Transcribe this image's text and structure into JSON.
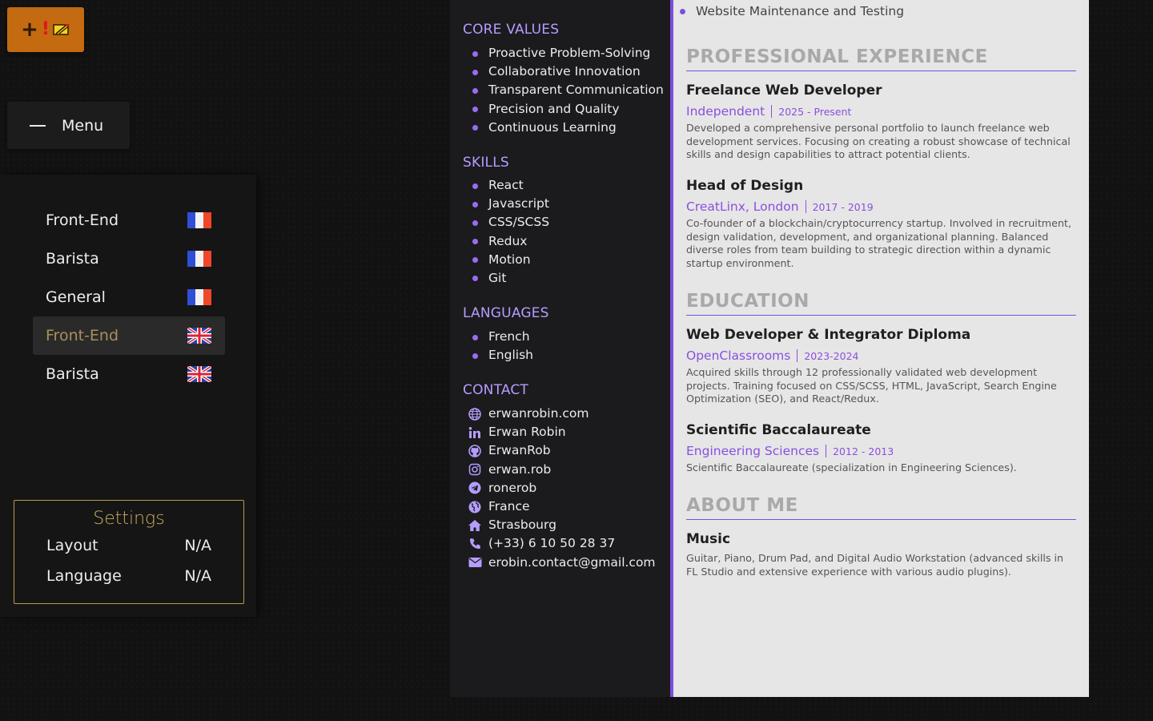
{
  "badge": {
    "plus": "+",
    "exclaim": "!"
  },
  "menu": {
    "label": "Menu"
  },
  "cv_list": [
    {
      "name": "Front-End",
      "lang": "fr",
      "active": false
    },
    {
      "name": "Barista",
      "lang": "fr",
      "active": false
    },
    {
      "name": "General",
      "lang": "fr",
      "active": false
    },
    {
      "name": "Front-End",
      "lang": "uk",
      "active": true
    },
    {
      "name": "Barista",
      "lang": "uk",
      "active": false
    }
  ],
  "settings": {
    "title": "Settings",
    "layout_label": "Layout",
    "layout_value": "N/A",
    "language_label": "Language",
    "language_value": "N/A"
  },
  "resume": {
    "left": {
      "core_values_title": "CORE VALUES",
      "core_values": [
        "Proactive Problem-Solving",
        "Collaborative Innovation",
        "Transparent Communication",
        "Precision and Quality",
        "Continuous Learning"
      ],
      "skills_title": "SKILLS",
      "skills": [
        "React",
        "Javascript",
        "CSS/SCSS",
        "Redux",
        "Motion",
        "Git"
      ],
      "languages_title": "LANGUAGES",
      "languages": [
        "French",
        "English"
      ],
      "contact_title": "CONTACT",
      "contact": [
        {
          "icon": "globe-icon",
          "text": "erwanrobin.com"
        },
        {
          "icon": "linkedin-icon",
          "text": "Erwan Robin"
        },
        {
          "icon": "github-icon",
          "text": "ErwanRob"
        },
        {
          "icon": "instagram-icon",
          "text": "erwan.rob"
        },
        {
          "icon": "telegram-icon",
          "text": "ronerob"
        },
        {
          "icon": "earth-icon",
          "text": "France"
        },
        {
          "icon": "home-icon",
          "text": "Strasbourg"
        },
        {
          "icon": "phone-icon",
          "text": "(+33) 6 10 50 28 37"
        },
        {
          "icon": "mail-icon",
          "text": "erobin.contact@gmail.com"
        }
      ]
    },
    "right": {
      "top_bullet": "Website Maintenance and Testing",
      "experience_title": "PROFESSIONAL EXPERIENCE",
      "experience": [
        {
          "title": "Freelance Web Developer",
          "org": "Independent",
          "period": "2025 - Present",
          "desc": "Developed a comprehensive personal portfolio to launch freelance web development services. Focusing on creating a robust showcase of technical skills and design capabilities to attract potential clients."
        },
        {
          "title": "Head of Design",
          "org": "CreatLinx, London",
          "period": "2017 - 2019",
          "desc": "Co-founder of a blockchain/cryptocurrency startup. Involved in recruitment, design validation, development, and organizational planning. Balanced diverse roles from team building to strategic direction within a dynamic startup environment."
        }
      ],
      "education_title": "EDUCATION",
      "education": [
        {
          "title": "Web Developer & Integrator Diploma",
          "org": "OpenClassrooms",
          "period": "2023-2024",
          "desc": "Acquired skills through 12 professionally validated web development projects. Training focused on CSS/SCSS, HTML, JavaScript, Search Engine Optimization (SEO), and React/Redux."
        },
        {
          "title": "Scientific Baccalaureate",
          "org": "Engineering Sciences",
          "period": "2012 - 2013",
          "desc": "Scientific Baccalaureate (specialization in Engineering Sciences)."
        }
      ],
      "about_title": "ABOUT ME",
      "about": [
        {
          "title": "Music",
          "desc": "Guitar, Piano, Drum Pad, and Digital Audio Workstation (advanced skills in FL Studio and extensive experience with various audio plugins)."
        }
      ]
    }
  },
  "colors": {
    "accent": "#7b4fe0",
    "gold": "#c9ab5e",
    "orange": "#c46a10"
  }
}
